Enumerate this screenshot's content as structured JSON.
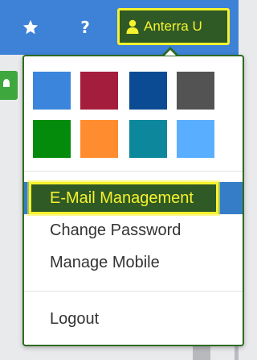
{
  "topbar": {
    "favorites_icon": "star-icon",
    "help_label": "?",
    "user_icon": "user-icon",
    "user_label": "Anterra U"
  },
  "menu": {
    "color_swatches": [
      "#3b86dc",
      "#a51d3c",
      "#0b4b93",
      "#535353",
      "#048b0c",
      "#ff8c2e",
      "#0c879b",
      "#5aaeff"
    ],
    "items": [
      {
        "label": "E-Mail Management",
        "active": true
      },
      {
        "label": "Change Password"
      },
      {
        "label": "Manage Mobile"
      },
      {
        "label": "Logout"
      }
    ]
  },
  "colors": {
    "topbar": "#3d82d6",
    "highlight_border": "#f7f22e",
    "highlight_fill": "#2f5a26",
    "active_item": "#357ec7"
  }
}
